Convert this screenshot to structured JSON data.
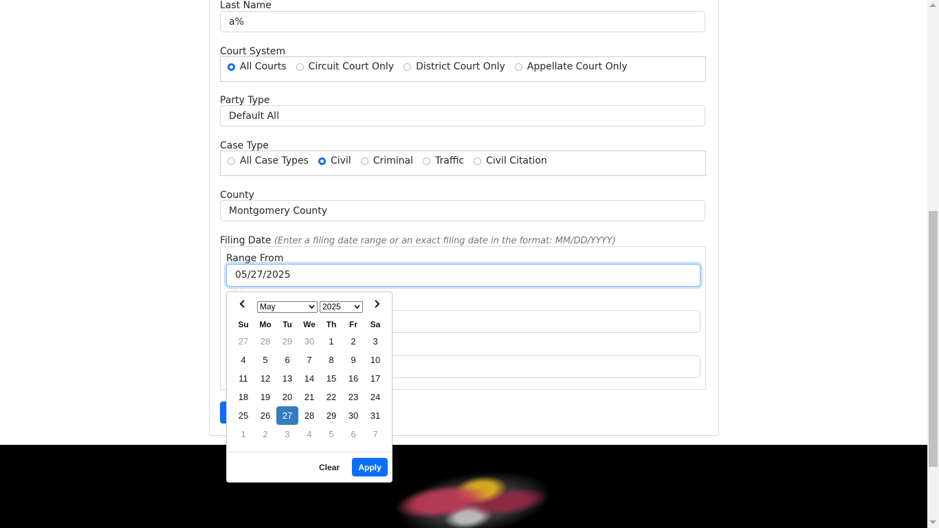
{
  "form": {
    "last_name_label": "Last Name",
    "last_name_value": "a%",
    "court_system_label": "Court System",
    "court_system_options": [
      "All Courts",
      "Circuit Court Only",
      "District Court Only",
      "Appellate Court Only"
    ],
    "court_system_selected": "All Courts",
    "party_type_label": "Party Type",
    "party_type_value": "Default All",
    "case_type_label": "Case Type",
    "case_type_options": [
      "All Case Types",
      "Civil",
      "Criminal",
      "Traffic",
      "Civil Citation"
    ],
    "case_type_selected": "Civil",
    "county_label": "County",
    "county_value": "Montgomery County",
    "filing_date_label": "Filing Date",
    "filing_date_hint": "(Enter a filing date range or an exact filing date in the format: MM/DD/YYYY)",
    "range_from_label": "Range From",
    "range_from_value": "05/27/2025"
  },
  "datepicker": {
    "month": "May",
    "year": "2025",
    "weekdays": [
      "Su",
      "Mo",
      "Tu",
      "We",
      "Th",
      "Fr",
      "Sa"
    ],
    "weeks": [
      [
        "27",
        "28",
        "29",
        "30",
        "1",
        "2",
        "3"
      ],
      [
        "4",
        "5",
        "6",
        "7",
        "8",
        "9",
        "10"
      ],
      [
        "11",
        "12",
        "13",
        "14",
        "15",
        "16",
        "17"
      ],
      [
        "18",
        "19",
        "20",
        "21",
        "22",
        "23",
        "24"
      ],
      [
        "25",
        "26",
        "27",
        "28",
        "29",
        "30",
        "31"
      ],
      [
        "1",
        "2",
        "3",
        "4",
        "5",
        "6",
        "7"
      ]
    ],
    "selected_day": "27",
    "clear_label": "Clear",
    "apply_label": "Apply"
  },
  "icons": {
    "prev": "chevron-left-icon",
    "next": "chevron-right-icon",
    "select_arrow": "chevron-down-icon"
  },
  "colors": {
    "accent": "#0d6efd",
    "selected_day": "#357ebd",
    "footer": "#000000"
  }
}
